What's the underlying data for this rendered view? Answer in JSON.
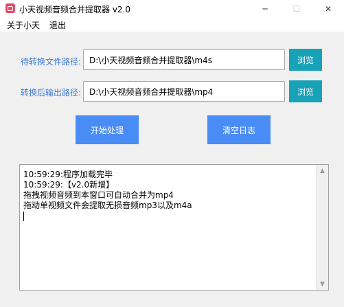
{
  "window": {
    "title": "小天视频音频合并提取器 v2.0",
    "controls": {
      "minimize": "─",
      "maximize": "☐",
      "close": "✕"
    }
  },
  "menu": {
    "items": [
      "关于小天",
      "退出"
    ]
  },
  "form": {
    "source_label": "待转换文件路径:",
    "source_value": "D:\\小天视频音频合并提取器\\m4s",
    "output_label": "转换后输出路径:",
    "output_value": "D:\\小天视频音频合并提取器\\mp4",
    "browse_label": "浏览"
  },
  "actions": {
    "start_label": "开始处理",
    "clear_label": "清空日志"
  },
  "log": {
    "lines": [
      "10:59:29:程序加载完毕",
      "10:59:29:【v2.0新增】",
      "拖拽视频音频到本窗口可自动合并为mp4",
      "拖动单视频文件会提取无损音频mp3以及m4a"
    ]
  },
  "icons": {
    "scroll_up": "▲",
    "scroll_down": "▼"
  },
  "colors": {
    "label": "#3b78d8",
    "browse_button": "#17a2b8",
    "action_button": "#4a8cf5",
    "app_icon": "#e5496a"
  }
}
